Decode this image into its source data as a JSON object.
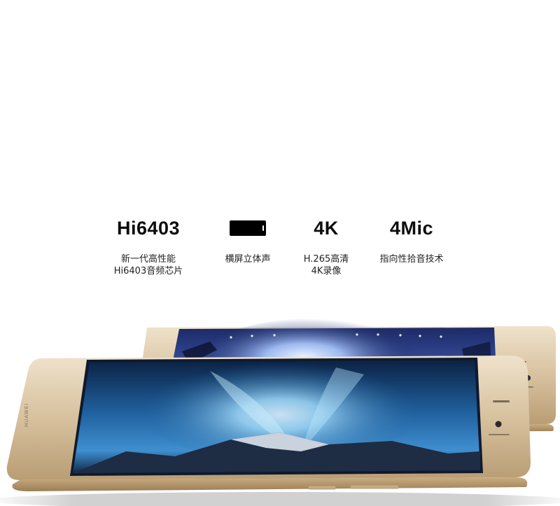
{
  "features": [
    {
      "title": "Hi6403",
      "desc_lines": [
        "新一代高性能",
        "Hi6403音频芯片"
      ]
    },
    {
      "title": "",
      "icon": "battery-icon",
      "desc_lines": [
        "横屏立体声"
      ]
    },
    {
      "title": "4K",
      "desc_lines": [
        "H.265高清",
        "4K录像"
      ]
    },
    {
      "title": "4Mic",
      "desc_lines": [
        "指向性拾音技术"
      ]
    }
  ],
  "phone": {
    "brand_text": "HUAWEI",
    "body_color": "#d8c3a1",
    "screen_front": "aurora",
    "screen_back": "concert"
  }
}
